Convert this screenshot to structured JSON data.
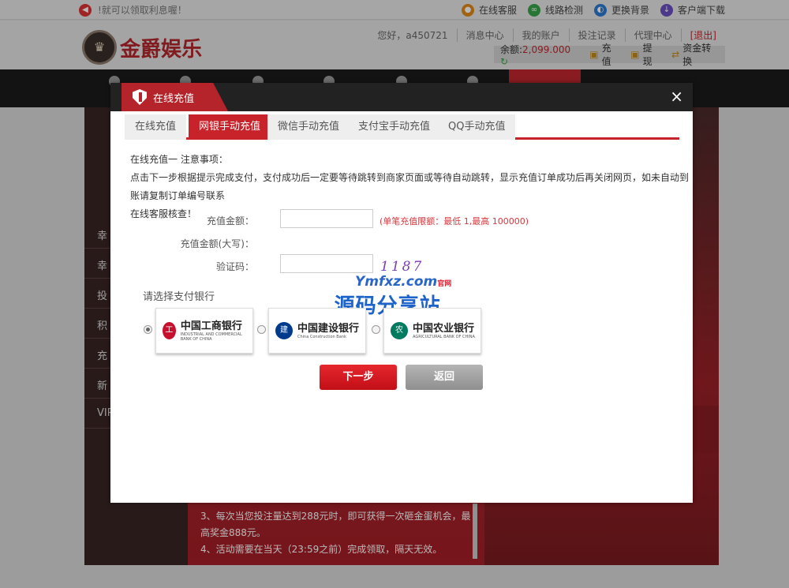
{
  "topbar": {
    "notice": "!就可以领取利息喔！",
    "links": [
      {
        "label": "在线客服",
        "icon": "chat-icon",
        "color": "#e08a1a"
      },
      {
        "label": "线路检测",
        "icon": "link-icon",
        "color": "#3aa34a"
      },
      {
        "label": "更换背景",
        "icon": "background-icon",
        "color": "#2a7bd1"
      },
      {
        "label": "客户端下载",
        "icon": "download-icon",
        "color": "#6a4fc0"
      }
    ]
  },
  "header": {
    "logo_text": "金爵娱乐",
    "greeting": "您好，",
    "username": "a450721",
    "links": [
      "消息中心",
      "我的账户",
      "投注记录",
      "代理中心"
    ],
    "logout": "[退出]",
    "balance_label": "余额:",
    "balance_value": "2,099.000",
    "actions": [
      "充值",
      "提现",
      "资金转换"
    ]
  },
  "sidebar": {
    "items": [
      "幸",
      "幸",
      "投",
      "积",
      "充",
      "新",
      "VIP"
    ]
  },
  "rules": {
    "line1": "3、每次当您投注量达到288元时，即可获得一次砸金蛋机会，最高奖金888元。",
    "line2": "4、活动需要在当天（23:59之前）完成领取，隔天无效。"
  },
  "modal": {
    "title": "在线充值",
    "close": "×",
    "tabs": [
      "在线充值",
      "网银手动充值",
      "微信手动充值",
      "支付宝手动充值",
      "QQ手动充值"
    ],
    "active_tab": 1,
    "notes_title": "在线充值一 注意事项：",
    "notes_body": "点击下一步根据提示完成支付，支付成功后一定要等待跳转到商家页面或等待自动跳转，显示充值订单成功后再关闭网页，如未自动到账请复制订单编号联系",
    "notes_tail": "在线客服核查！",
    "amount_label": "充值金额：",
    "amount_value": "",
    "amount_words_label": "充值金额(大写)：",
    "captcha_label": "验证码：",
    "captcha_value": "",
    "limit_text": "(单笔充值限额：最低 1,最高 100000)",
    "captcha_code": "1187",
    "choose_bank": "请选择支付银行",
    "banks": [
      {
        "name": "中国工商银行",
        "sub": "INDUSTRIAL AND COMMERCIAL BANK OF CHINA",
        "color": "#c8102e",
        "selected": true
      },
      {
        "name": "中国建设银行",
        "sub": "China Construction Bank",
        "color": "#003a8c",
        "selected": false
      },
      {
        "name": "中国农业银行",
        "sub": "AGRICULTURAL BANK OF CHINA",
        "color": "#007b5f",
        "selected": false
      }
    ],
    "next_button": "下一步",
    "back_button": "返回"
  },
  "watermark": {
    "url": "Ymfxz.com",
    "tag": "官网",
    "name": "源码分享站"
  }
}
